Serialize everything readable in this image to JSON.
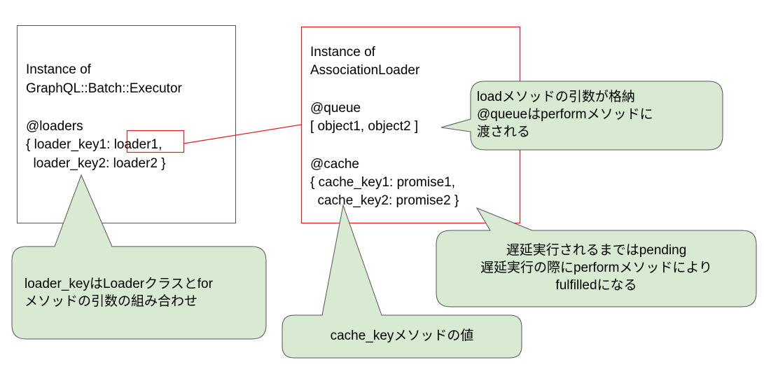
{
  "executor_box": {
    "title_line1": "Instance of",
    "title_line2": "GraphQL::Batch::Executor",
    "field": "@loaders",
    "line_a_prefix": "{ loader_key1: ",
    "line_a_loader": "loader1",
    "line_a_suffix": ",",
    "line_b": "  loader_key2: loader2 }"
  },
  "loader_box": {
    "title_line1": "Instance of",
    "title_line2": "AssociationLoader",
    "queue_field": "@queue",
    "queue_value": "[ object1, object2 ]",
    "cache_field": "@cache",
    "cache_line1": "{ cache_key1: promise1,",
    "cache_line2": "  cache_key2: promise2 }"
  },
  "callouts": {
    "loader_key": {
      "line1": "loader_keyはLoaderクラスとfor",
      "line2": "メソッドの引数の組み合わせ"
    },
    "queue": {
      "line1": "loadメソッドの引数が格納",
      "line2": "@queueはperformメソッドに",
      "line3": "渡される"
    },
    "promise": {
      "line1": "遅延実行されるまではpending",
      "line2": "遅延実行の際にperformメソッドにより",
      "line3": "fulfilledになる"
    },
    "cache_key": {
      "line1": "cache_keyメソッドの値"
    }
  },
  "colors": {
    "executor_border": "#555555",
    "loader_border": "#e02020",
    "highlight_border": "#e02020",
    "connector": "#e02020",
    "callout_fill": "#d9ead3",
    "callout_stroke": "#555555"
  }
}
